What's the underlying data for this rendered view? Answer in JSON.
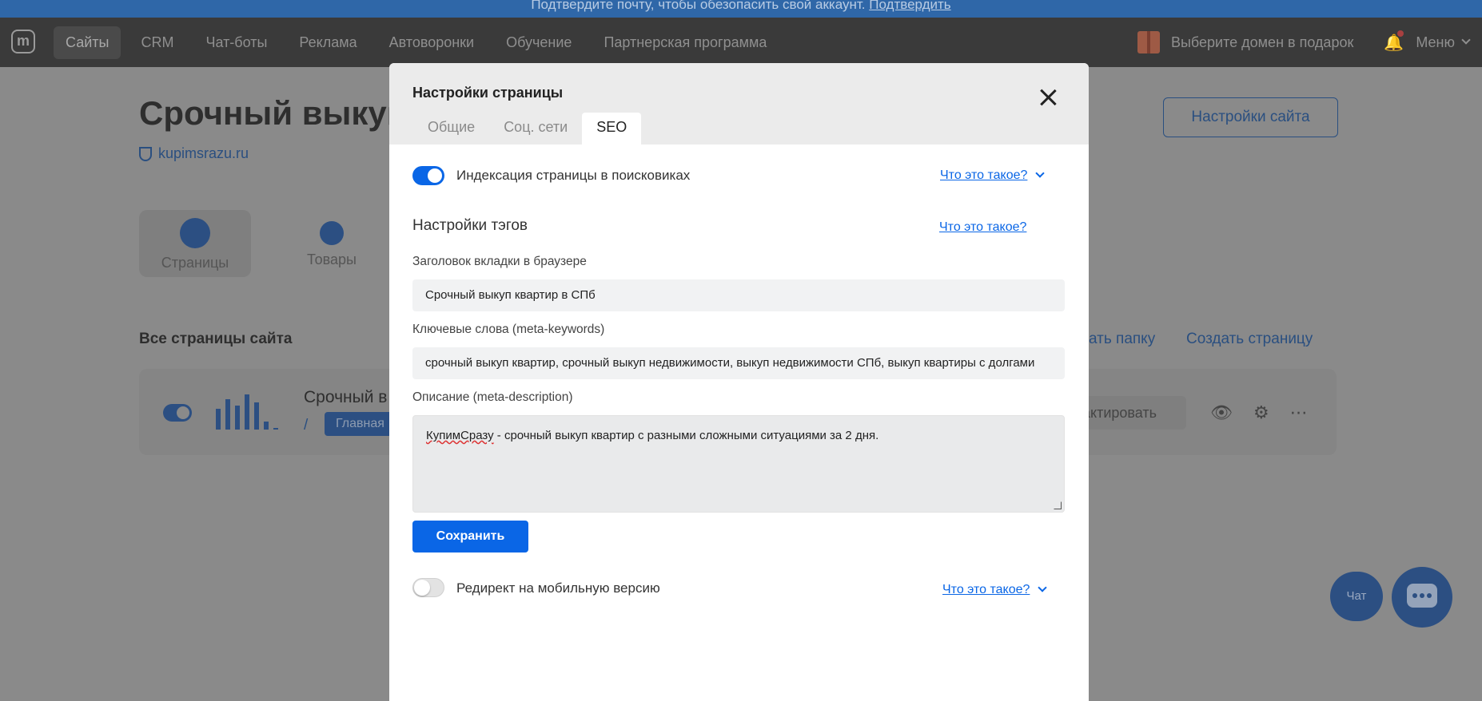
{
  "banner": {
    "text": "Подтвердите почту, чтобы обезопасить свой аккаунт.",
    "link": "Подтвердить"
  },
  "nav": {
    "logo": "m",
    "items": [
      "Сайты",
      "CRM",
      "Чат-боты",
      "Реклама",
      "Автоворонки",
      "Обучение",
      "Партнерская программа"
    ],
    "gift_text": "Выберите домен в подарок",
    "menu": "Меню"
  },
  "background": {
    "site_title": "Срочный выкуп",
    "domain": "kupimsrazu.ru",
    "site_settings": "Настройки сайта",
    "tiles": [
      "Страницы",
      "Товары"
    ],
    "section_title": "Все страницы сайта",
    "create_folder": "ать папку",
    "create_page": "Создать страницу",
    "row_title": "Срочный в",
    "row_slash": "/",
    "row_chip": "Главная",
    "edit": "актировать",
    "chat": "Чат"
  },
  "modal": {
    "title": "Настройки страницы",
    "tabs": [
      "Общие",
      "Соц. сети",
      "SEO"
    ],
    "indexing_label": "Индексация страницы в поисковиках",
    "help": "Что это такое?",
    "tags_title": "Настройки тэгов",
    "browser_title_label": "Заголовок вкладки в браузере",
    "browser_title_value": "Срочный выкуп квартир в СПб",
    "keywords_label": "Ключевые слова (meta-keywords)",
    "keywords_value": "срочный выкуп квартир, срочный выкуп недвижимости, выкуп недвижимости СПб, выкуп квартиры с долгами",
    "description_label": "Описание (meta-description)",
    "description_brand": "КупимСразу",
    "description_rest": " - срочный выкуп квартир с разными сложными ситуациями за 2 дня.",
    "save": "Сохранить",
    "redirect_label": "Редирект на мобильную версию"
  }
}
